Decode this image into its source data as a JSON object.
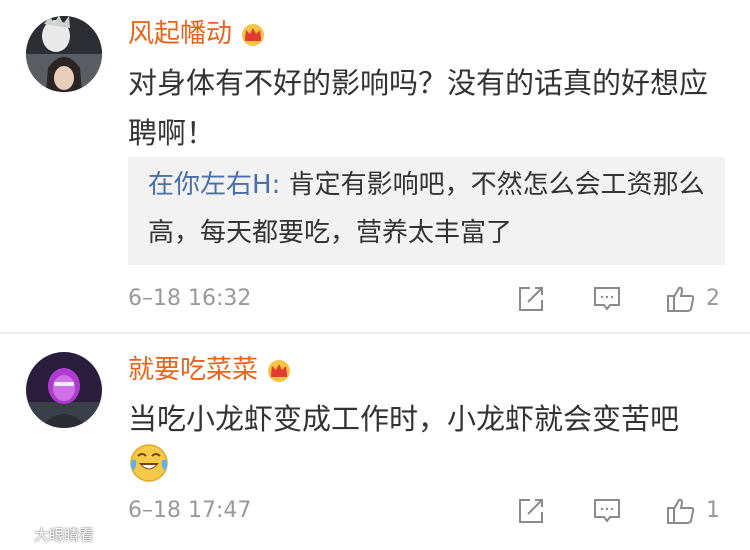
{
  "comments": [
    {
      "username": "风起幡动",
      "body": "对身体有不好的影响吗？没有的话真的好想应聘啊！",
      "reply": {
        "user": "在你左右H",
        "separator": ": ",
        "text": "肯定有影响吧，不然怎么会工资那么高，每天都要吃，营养太丰富了"
      },
      "timestamp": "6–18 16:32",
      "likes": "2"
    },
    {
      "username": "就要吃菜菜",
      "body": "当吃小龙虾变成工作时，小龙虾就会变苦吧",
      "emoji": "laughing-crying-emoji",
      "timestamp": "6–18 17:47",
      "likes": "1"
    }
  ],
  "icons": {
    "vip": "crown-icon",
    "repost": "repost-icon",
    "comment": "comment-icon",
    "like": "thumbs-up-icon"
  },
  "colors": {
    "username": "#e8641b",
    "reply_user": "#4a6ea8",
    "meta": "#999999",
    "reply_bg": "#f2f2f2"
  },
  "watermark": {
    "text": "大眼睛看"
  }
}
